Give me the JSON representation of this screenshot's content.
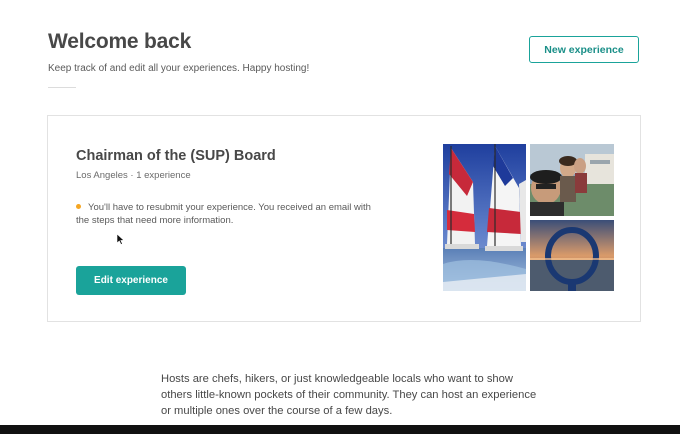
{
  "header": {
    "title": "Welcome back",
    "subtitle": "Keep track of and edit all your experiences. Happy hosting!",
    "new_button_label": "New experience"
  },
  "experience_card": {
    "title": "Chairman of the (SUP) Board",
    "meta": "Los Angeles · 1 experience",
    "notice": "You'll have to resubmit your experience. You received an email with the steps that need more information.",
    "notice_color": "#f5a623",
    "edit_button_label": "Edit experience",
    "photos": [
      "sailboats-on-water-photo",
      "group-selfie-photo",
      "sunset-lifebuoy-photo"
    ]
  },
  "info_text": "Hosts are chefs, hikers, or just knowledgeable locals who want to show others little-known pockets of their community. They can host an experience or multiple ones over the course of a few days.",
  "colors": {
    "accent": "#1aa39a",
    "text": "#484848",
    "border": "#e2e2e2"
  }
}
